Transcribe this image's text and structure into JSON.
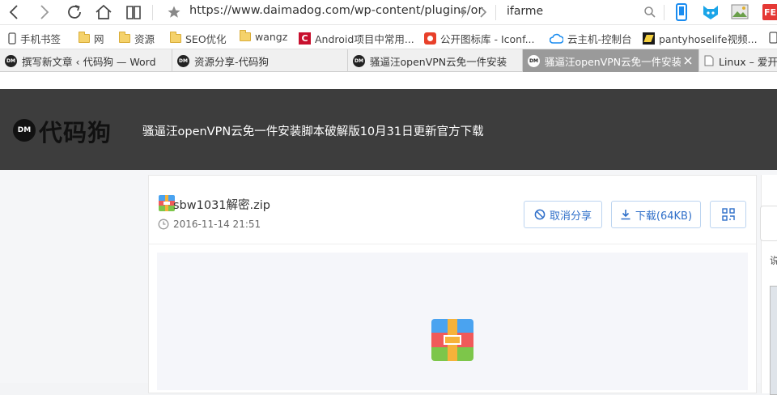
{
  "browser": {
    "url": "https://www.daimadog.com/wp-content/plugins/or",
    "search_text": "ifarme",
    "badge": "FE"
  },
  "bookmarks": [
    {
      "label": "手机书签",
      "icon": "phone-icon"
    },
    {
      "label": "网",
      "icon": "folder-icon"
    },
    {
      "label": "资源",
      "icon": "folder-icon"
    },
    {
      "label": "SEO优化",
      "icon": "folder-icon"
    },
    {
      "label": "wangz",
      "icon": "folder-icon"
    },
    {
      "label": "Android项目中常用...",
      "icon": "android-c-icon"
    },
    {
      "label": "公开图标库 - Iconf...",
      "icon": "iconfont-icon"
    },
    {
      "label": "云主机-控制台",
      "icon": "cloud-icon"
    },
    {
      "label": "pantyhoselife视频...",
      "icon": "site-icon"
    }
  ],
  "tabs": [
    {
      "label": "撰写新文章 ‹ 代码狗 — Word"
    },
    {
      "label": "资源分享-代码狗"
    },
    {
      "label": "骚逼汪openVPN云免一件安装"
    },
    {
      "label": "骚逼汪openVPN云免一件安装",
      "active": true
    },
    {
      "label": "Linux – 爱开"
    }
  ],
  "header": {
    "logo_badge": "DM",
    "logo_text": "代码狗",
    "title": "骚逼汪openVPN云免一件安装脚本破解版10月31日更新官方下载"
  },
  "file": {
    "name": "sbw1031解密.zip",
    "date": "2016-11-14 21:51",
    "cancel_share_label": "取消分享",
    "download_label": "下载(64KB)"
  },
  "side": {
    "text": "说"
  },
  "colors": {
    "header_bg": "#3d3d3d",
    "accent_blue": "#2f6fc9",
    "active_tab": "#9a9a9a"
  }
}
